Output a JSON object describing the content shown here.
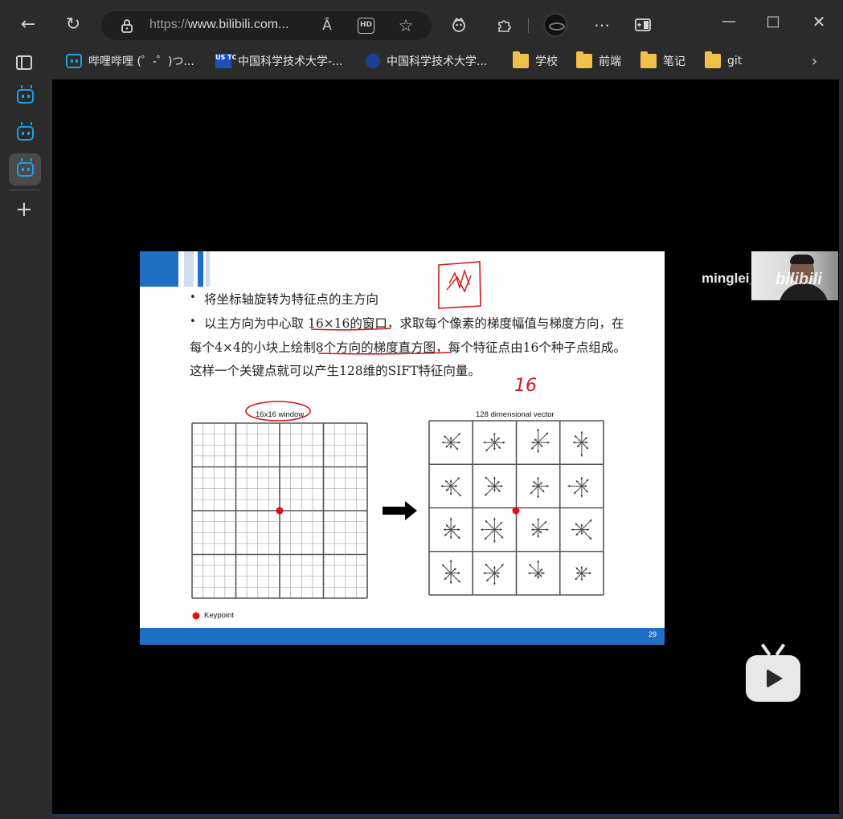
{
  "browser": {
    "url_prefix": "https://",
    "url_host": "www.bilibili.com...",
    "read_aloud_icon": "Ȃ",
    "hd_label": "HD"
  },
  "bookmarks": [
    {
      "label": "哔哩哔哩 (゜-゜)つ...",
      "icon": "bilibili-icon"
    },
    {
      "label": "中国科学技术大学-...",
      "icon": "ustc-icon",
      "icon_text": "US TC"
    },
    {
      "label": "中国科学技术大学...",
      "icon": "ustc-emblem-icon"
    },
    {
      "label": "学校",
      "icon": "folder-icon"
    },
    {
      "label": "前端",
      "icon": "folder-icon"
    },
    {
      "label": "笔记",
      "icon": "folder-icon"
    },
    {
      "label": "git",
      "icon": "folder-icon"
    }
  ],
  "slide": {
    "bullet1": "将坐标轴旋转为特征点的主方向",
    "bullet2_a": "以主方向为中心取",
    "bullet2_b": "16×16的窗口",
    "bullet2_c": "，求取每个像素的梯度幅值与梯度方向，在",
    "line2_a": "每个4×4的小块上绘制",
    "line2_b": "8个方向的梯度直方图，",
    "line2_c": "每个特征点由16个种子点组成。",
    "line3": "这样一个关键点就可以产生128维的SIFT特征向量。",
    "left_caption": "16x16 window",
    "right_caption": "128 dimensional vector",
    "legend": "Keypoint",
    "page_number": "29",
    "handwritten_number": "16",
    "colors": {
      "blue": "#1f6fc7",
      "red_ink": "#d01818"
    }
  },
  "overlay": {
    "streamer_name": "minglei_li",
    "watermark": "bilibili"
  }
}
